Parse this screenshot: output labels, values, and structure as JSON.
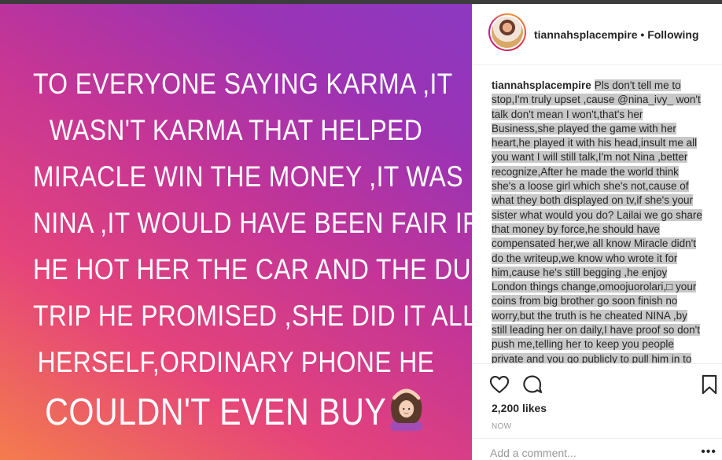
{
  "post": {
    "story_lines": [
      "TO EVERYONE SAYING KARMA ,IT",
      "WASN'T KARMA THAT HELPED",
      "MIRACLE WIN THE MONEY ,IT WAS",
      "NINA ,IT WOULD HAVE BEEN FAIR IF",
      "HE HOT HER THE CAR AND THE DUBAI",
      "TRIP HE PROMISED ,SHE DID IT ALL BY",
      "HERSELF,ORDINARY PHONE HE",
      "COULDN'T EVEN BUY"
    ],
    "emoji_icon": "person-gesturing-ok-emoji",
    "gradient_colors": [
      "#f47c4c",
      "#e5447a",
      "#c43596",
      "#8c39c1"
    ]
  },
  "header": {
    "username": "tiannahsplacempire",
    "separator": "•",
    "follow_state": "Following"
  },
  "caption": {
    "username": "tiannahsplacempire",
    "text": "Pls don't tell me to stop,I'm truly upset ,cause @nina_ivy_ won't talk don't mean I won't,that's her Business,she played the game with her heart,he played it with his head,insult me all you want I will still talk,I'm not Nina ,better recognize,After he made the world think she's a loose girl which she's not,cause of what they both displayed on tv,if she's your sister what would you do? Lailai we go share that money by force,he should have compensated her,we all know Miracle didn't do the writeup,we know who wrote it for him,cause he's still begging ,he enjoy London things change,omoojuorolari,□ your coins from big brother go soon finish no worry,but the truth is he cheated NINA ,by still leading her on daily,I have proof so don't push me,telling her to keep you people private and you go publicly to pull him in to your with your own tags,This"
  },
  "actions": {
    "like_icon": "heart-icon",
    "comment_icon": "comment-bubble-icon",
    "save_icon": "bookmark-icon",
    "likes_count": "2,200",
    "likes_word": "likes",
    "timestamp": "NOW"
  },
  "comment": {
    "placeholder": "Add a comment...",
    "more_label": "•••"
  },
  "colors": {
    "topbar": "#3c3c3c",
    "caption_highlight": "#c8c8c8",
    "text": "#262626",
    "muted": "#999999"
  }
}
